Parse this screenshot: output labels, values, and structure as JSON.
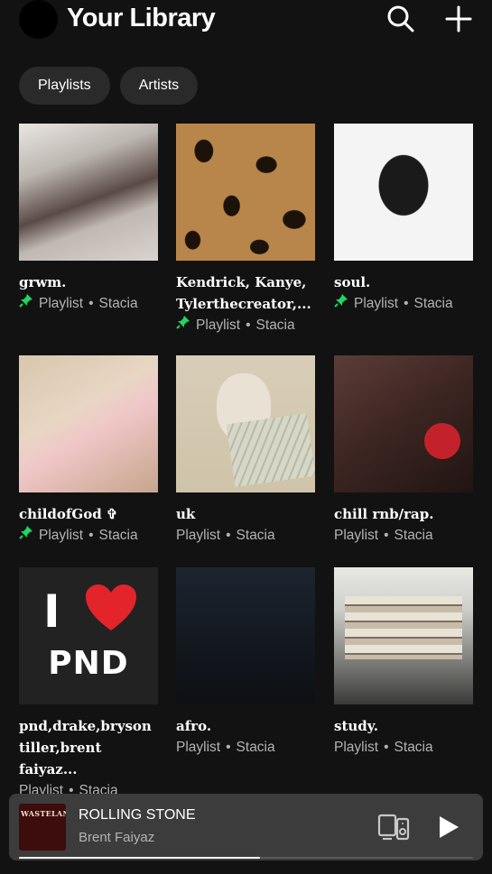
{
  "header": {
    "title": "Your Library",
    "search_icon": "search-icon",
    "add_icon": "plus-icon"
  },
  "filters": [
    "Playlists",
    "Artists"
  ],
  "items": [
    {
      "name": "grwm.",
      "type": "Playlist",
      "owner": "Stacia",
      "pinned": true
    },
    {
      "name": "Kendrick, Kanye, Tylerthecreator,...",
      "type": "Playlist",
      "owner": "Stacia",
      "pinned": true
    },
    {
      "name": "soul.",
      "type": "Playlist",
      "owner": "Stacia",
      "pinned": true
    },
    {
      "name": "childofGod ✞",
      "type": "Playlist",
      "owner": "Stacia",
      "pinned": true
    },
    {
      "name": "uk",
      "type": "Playlist",
      "owner": "Stacia",
      "pinned": false
    },
    {
      "name": "chill rnb/rap.",
      "type": "Playlist",
      "owner": "Stacia",
      "pinned": false
    },
    {
      "name": "pnd,drake,bryson tiller,brent faiyaz...",
      "type": "Playlist",
      "owner": "Stacia",
      "pinned": false
    },
    {
      "name": "afro.",
      "type": "Playlist",
      "owner": "Stacia",
      "pinned": false
    },
    {
      "name": "study.",
      "type": "Playlist",
      "owner": "Stacia",
      "pinned": false
    }
  ],
  "pnd_art": {
    "letter": "I",
    "text": "PND"
  },
  "now_playing": {
    "title": "ROLLING STONE",
    "artist": "Brent Faiyaz",
    "album_text": "WASTELAND",
    "progress": 0.53
  },
  "colors": {
    "background": "#121212",
    "pin": "#1ed760",
    "chip": "#2a2a2a",
    "player": "#3c3c3c"
  }
}
